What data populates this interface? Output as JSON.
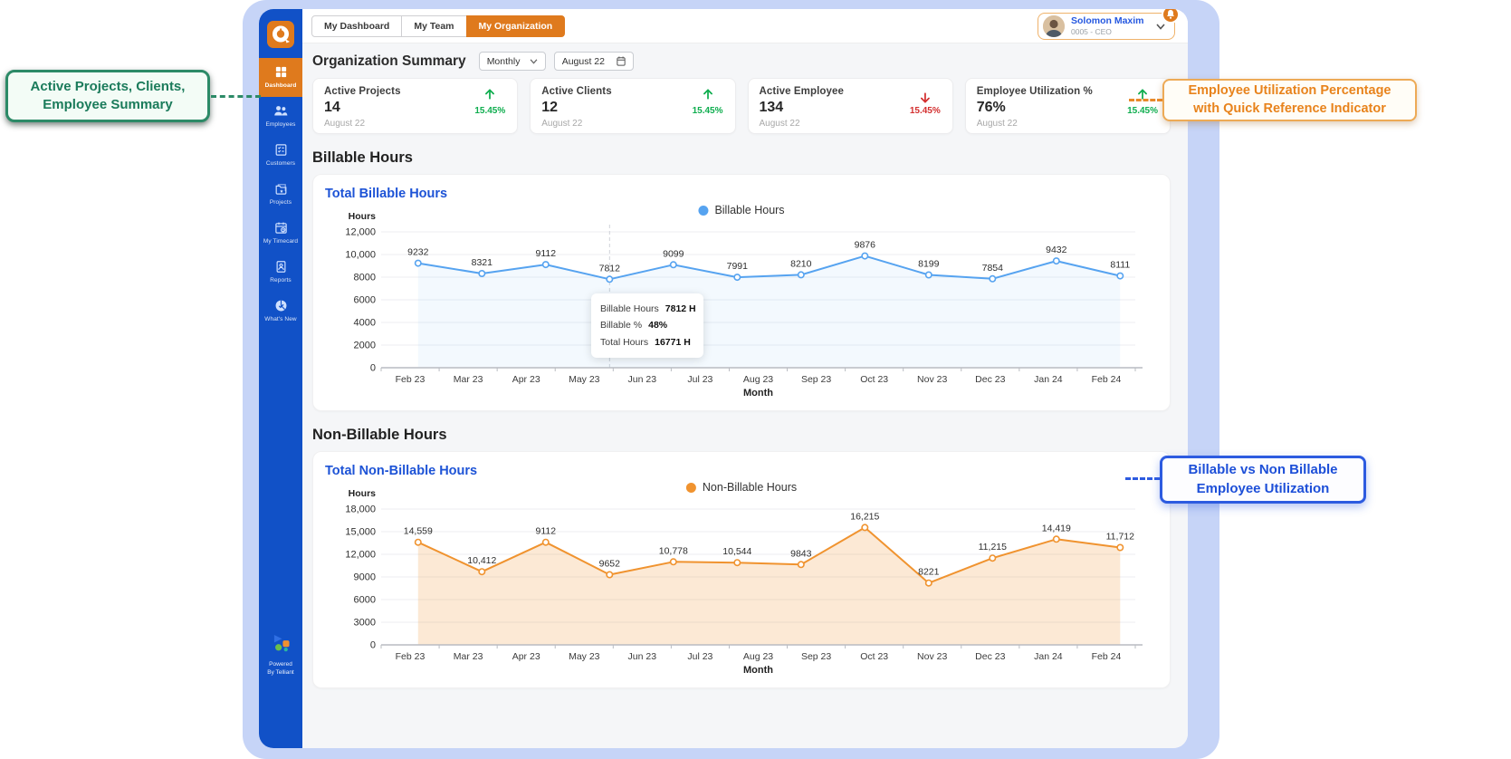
{
  "topbar": {
    "tabs": [
      {
        "id": "my-dashboard",
        "label": "My Dashboard",
        "active": false
      },
      {
        "id": "my-team",
        "label": "My Team",
        "active": false
      },
      {
        "id": "my-organization",
        "label": "My Organization",
        "active": true
      }
    ],
    "user": {
      "name": "Solomon Maxim",
      "meta": "0005 - CEO"
    }
  },
  "sidebar": {
    "items": [
      {
        "id": "dashboard",
        "label": "Dashboard",
        "icon": "dashboard-icon",
        "active": true
      },
      {
        "id": "employees",
        "label": "Employees",
        "icon": "employees-icon",
        "active": false
      },
      {
        "id": "customers",
        "label": "Customers",
        "icon": "customers-icon",
        "active": false
      },
      {
        "id": "projects",
        "label": "Projects",
        "icon": "projects-icon",
        "active": false
      },
      {
        "id": "my-timecard",
        "label": "My Timecard",
        "icon": "timecard-icon",
        "active": false
      },
      {
        "id": "reports",
        "label": "Reports",
        "icon": "reports-icon",
        "active": false
      },
      {
        "id": "whats-new",
        "label": "What's New",
        "icon": "whats-new-icon",
        "active": false
      }
    ],
    "powered_by": "Powered\nBy Telliant"
  },
  "summary": {
    "title": "Organization Summary",
    "period_select": {
      "value": "Monthly"
    },
    "date_select": {
      "value": "August 22"
    },
    "cards": [
      {
        "label": "Active Projects",
        "value": "14",
        "date": "August 22",
        "change": "15.45%",
        "direction": "up"
      },
      {
        "label": "Active Clients",
        "value": "12",
        "date": "August 22",
        "change": "15.45%",
        "direction": "up"
      },
      {
        "label": "Active Employee",
        "value": "134",
        "date": "August 22",
        "change": "15.45%",
        "direction": "down"
      },
      {
        "label": "Employee Utilization %",
        "value": "76%",
        "date": "August 22",
        "change": "15.45%",
        "direction": "up"
      }
    ]
  },
  "sections": {
    "billable": "Billable Hours",
    "nonbillable": "Non-Billable Hours"
  },
  "chart_data": [
    {
      "type": "line",
      "title": "Total Billable Hours",
      "legend": "Billable Hours",
      "ylabel": "Hours",
      "xlabel": "Month",
      "x": [
        "Feb 23",
        "Mar 23",
        "Apr 23",
        "May 23",
        "Jun 23",
        "Jul 23",
        "Aug 23",
        "Sep 23",
        "Oct 23",
        "Nov 23",
        "Dec 23",
        "Jan 24",
        "Feb 24"
      ],
      "values": [
        9232,
        8321,
        9112,
        7812,
        9099,
        7991,
        8210,
        9876,
        8199,
        7854,
        9432,
        8111
      ],
      "value_labels": [
        "9232",
        "8321",
        "9112",
        "7812",
        "9099",
        "7991",
        "8210",
        "9876",
        "8199",
        "7854",
        "9432",
        "8111"
      ],
      "ylim": [
        0,
        12000
      ],
      "yticks": [
        {
          "label": "12,000",
          "value": 12000
        },
        {
          "label": "10,000",
          "value": 10000
        },
        {
          "label": "8000",
          "value": 8000
        },
        {
          "label": "6000",
          "value": 6000
        },
        {
          "label": "4000",
          "value": 4000
        },
        {
          "label": "2000",
          "value": 2000
        },
        {
          "label": "0",
          "value": 0
        }
      ],
      "grid": true,
      "legend_position": "top-center",
      "color": "#56a3f0",
      "fill": "rgba(86,163,240,0.07)",
      "crosshair_index": 3,
      "tooltip": {
        "rows": [
          {
            "label": "Billable Hours",
            "value": "7812 H"
          },
          {
            "label": "Billable %",
            "value": "48%"
          },
          {
            "label": "Total Hours",
            "value": "16771 H"
          }
        ]
      }
    },
    {
      "type": "area",
      "title": "Total Non-Billable Hours",
      "legend": "Non-Billable Hours",
      "ylabel": "Hours",
      "xlabel": "Month",
      "x": [
        "Feb 23",
        "Mar 23",
        "Apr 23",
        "May 23",
        "Jun 23",
        "Jul 23",
        "Aug 23",
        "Sep 23",
        "Oct 23",
        "Nov 23",
        "Dec 23",
        "Jan 24",
        "Feb 24"
      ],
      "values": [
        14559,
        10412,
        9112,
        9652,
        10778,
        10544,
        9843,
        16215,
        8221,
        11215,
        14419,
        11712
      ],
      "value_labels": [
        "14,559",
        "10,412",
        "9112",
        "9652",
        "10,778",
        "10,544",
        "9843",
        "16,215",
        "8221",
        "11,215",
        "14,419",
        "11,712"
      ],
      "render_values": [
        13600,
        9700,
        13600,
        9300,
        11000,
        10900,
        10650,
        15550,
        8200,
        11500,
        14000,
        12900
      ],
      "ylim": [
        0,
        18000
      ],
      "yticks": [
        {
          "label": "18,000",
          "value": 18000
        },
        {
          "label": "15,000",
          "value": 15000
        },
        {
          "label": "12,000",
          "value": 12000
        },
        {
          "label": "9000",
          "value": 9000
        },
        {
          "label": "6000",
          "value": 6000
        },
        {
          "label": "3000",
          "value": 3000
        },
        {
          "label": "0",
          "value": 0
        }
      ],
      "grid": true,
      "legend_position": "top-center",
      "color": "#f0932f",
      "fill": "rgba(240,147,47,0.20)"
    }
  ],
  "annotations": {
    "left_green": "Active Projects, Clients,\nEmployee Summary",
    "right_orange": "Employee Utilization Percentage\nwith Quick Reference Indicator",
    "right_blue": "Billable vs Non Billable\nEmployee Utilization"
  },
  "colors": {
    "sidebar_blue": "#1151c7",
    "accent_orange": "#df7a1d",
    "frame_lavender": "#c6d4f7",
    "positive_green": "#0ead4e",
    "negative_red": "#d32f2f",
    "billable_line": "#56a3f0",
    "nonbillable_line": "#f0932f",
    "chart_title_blue": "#1d53d6",
    "callout_green": "#2c8a67",
    "callout_orange": "#e8831c",
    "callout_blue": "#2d5be0"
  }
}
